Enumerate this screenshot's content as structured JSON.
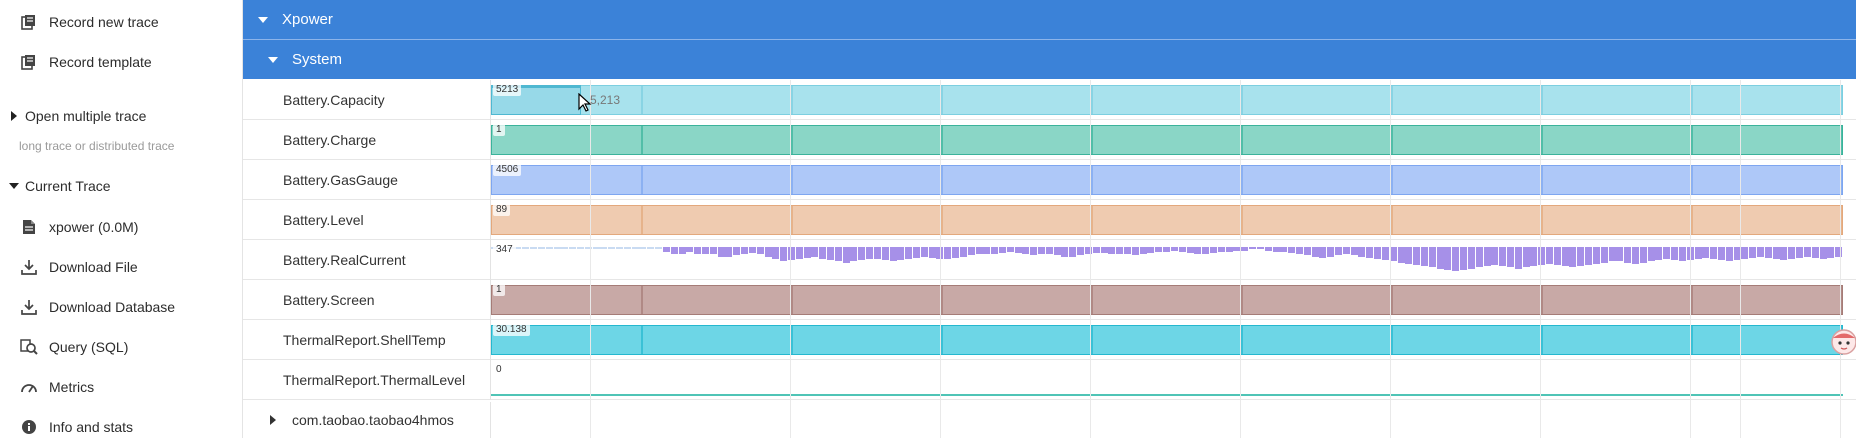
{
  "sidebar": {
    "record_new_trace": "Record new trace",
    "record_template": "Record template",
    "open_multiple_trace": "Open multiple trace",
    "open_multiple_hint": "long trace or distributed trace",
    "current_trace": "Current Trace",
    "items": [
      {
        "label": "xpower (0.0M)",
        "icon": "file-icon"
      },
      {
        "label": "Download File",
        "icon": "download-icon"
      },
      {
        "label": "Download Database",
        "icon": "download-icon"
      },
      {
        "label": "Query (SQL)",
        "icon": "search-icon"
      },
      {
        "label": "Metrics",
        "icon": "gauge-icon"
      },
      {
        "label": "Info and stats",
        "icon": "info-icon"
      }
    ]
  },
  "groups": {
    "xpower": "Xpower",
    "system": "System"
  },
  "tracks": [
    {
      "name": "Battery.Capacity",
      "value": "5213",
      "color": "#a8e2ed",
      "stroke": "#7ccfe0",
      "type": "segments"
    },
    {
      "name": "Battery.Charge",
      "value": "1",
      "color": "#8ad6c6",
      "stroke": "#3bb39b",
      "type": "segments"
    },
    {
      "name": "Battery.GasGauge",
      "value": "4506",
      "color": "#aec8f8",
      "stroke": "#7ea6f0",
      "type": "segments"
    },
    {
      "name": "Battery.Level",
      "value": "89",
      "color": "#efcbb0",
      "stroke": "#e3a87c",
      "type": "segments"
    },
    {
      "name": "Battery.RealCurrent",
      "value": "347",
      "color": "#a690e8",
      "stroke": "#8b72de",
      "type": "bars"
    },
    {
      "name": "Battery.Screen",
      "value": "1",
      "color": "#c8a9a6",
      "stroke": "#a57c77",
      "type": "segments"
    },
    {
      "name": "ThermalReport.ShellTemp",
      "value": "30.138",
      "color": "#6dd6e6",
      "stroke": "#25b8cf",
      "type": "segments"
    },
    {
      "name": "ThermalReport.ThermalLevel",
      "value": "0",
      "color": "#ffffff",
      "stroke": "#4fc4b6",
      "type": "line"
    }
  ],
  "process": {
    "name": "com.taobao.taobao4hmos"
  },
  "hover_value": "5,213",
  "real_current_levels": [
    0.1,
    0.1,
    0.1,
    0.1,
    0.1,
    0.1,
    0.1,
    0.1,
    0.1,
    0.1,
    0.1,
    0.1,
    0.1,
    0.1,
    0.1,
    0.1,
    0.1,
    0.1,
    0.1,
    0.1,
    0.1,
    0.1,
    0.2,
    0.3,
    0.3,
    0.2,
    0.3,
    0.3,
    0.3,
    0.4,
    0.4,
    0.35,
    0.3,
    0.25,
    0.3,
    0.4,
    0.5,
    0.6,
    0.55,
    0.5,
    0.45,
    0.4,
    0.5,
    0.55,
    0.6,
    0.65,
    0.6,
    0.55,
    0.5,
    0.5,
    0.55,
    0.6,
    0.55,
    0.5,
    0.45,
    0.4,
    0.45,
    0.5,
    0.5,
    0.45,
    0.4,
    0.35,
    0.3,
    0.3,
    0.3,
    0.25,
    0.2,
    0.25,
    0.3,
    0.35,
    0.3,
    0.3,
    0.35,
    0.4,
    0.4,
    0.35,
    0.3,
    0.25,
    0.25,
    0.3,
    0.3,
    0.3,
    0.35,
    0.3,
    0.25,
    0.2,
    0.2,
    0.15,
    0.2,
    0.25,
    0.3,
    0.3,
    0.25,
    0.2,
    0.2,
    0.15,
    0.15,
    0.1,
    0.1,
    0.15,
    0.2,
    0.2,
    0.25,
    0.3,
    0.35,
    0.4,
    0.45,
    0.4,
    0.35,
    0.3,
    0.35,
    0.4,
    0.45,
    0.5,
    0.55,
    0.6,
    0.65,
    0.7,
    0.75,
    0.8,
    0.85,
    0.9,
    0.95,
    1.0,
    0.95,
    0.9,
    0.85,
    0.8,
    0.75,
    0.8,
    0.85,
    0.9,
    0.85,
    0.8,
    0.75,
    0.7,
    0.75,
    0.8,
    0.85,
    0.8,
    0.75,
    0.7,
    0.65,
    0.6,
    0.6,
    0.65,
    0.7,
    0.65,
    0.6,
    0.55,
    0.5,
    0.55,
    0.6,
    0.55,
    0.5,
    0.45,
    0.5,
    0.55,
    0.6,
    0.55,
    0.5,
    0.45,
    0.4,
    0.45,
    0.5,
    0.55,
    0.5,
    0.45,
    0.4,
    0.45,
    0.5,
    0.45,
    0.4
  ]
}
